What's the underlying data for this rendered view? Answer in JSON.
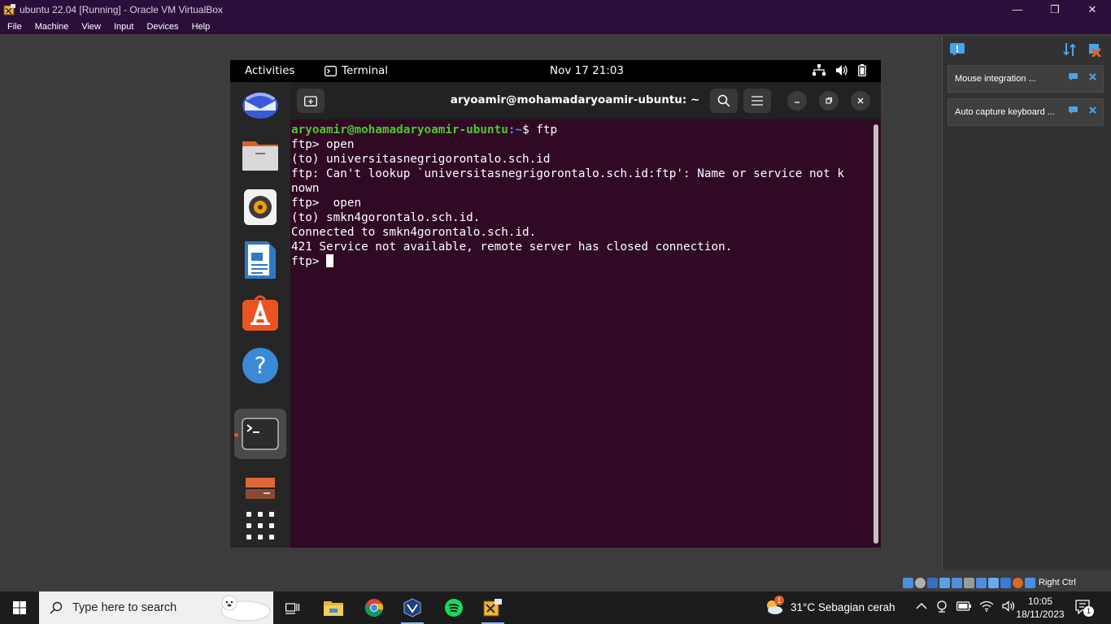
{
  "window": {
    "title": "ubuntu 22.04 [Running] - Oracle VM VirtualBox",
    "minimize": "—",
    "maximize": "❐",
    "close": "✕"
  },
  "menu": [
    "File",
    "Machine",
    "View",
    "Input",
    "Devices",
    "Help"
  ],
  "gnome": {
    "activities": "Activities",
    "app_name": "Terminal",
    "clock": "Nov 17  21:03"
  },
  "dock_icons": [
    "thunderbird-icon",
    "files-icon",
    "rhythmbox-icon",
    "writer-icon",
    "app-center-icon",
    "help-icon",
    "terminal-icon",
    "disk-icon",
    "show-apps-icon"
  ],
  "terminal": {
    "title": "aryoamir@mohamadaryoamir-ubuntu: ~",
    "prompt_user": "aryoamir@mohamadaryoamir-ubuntu",
    "prompt_path": ":~",
    "first_cmd": "$ ftp",
    "lines": [
      "ftp> open",
      "(to) universitasnegrigorontalo.sch.id",
      "ftp: Can't lookup `universitasnegrigorontalo.sch.id:ftp': Name or service not k",
      "nown",
      "ftp>  open",
      "(to) smkn4gorontalo.sch.id.",
      "Connected to smkn4gorontalo.sch.id.",
      "421 Service not available, remote server has closed connection."
    ],
    "last_prompt": "ftp> "
  },
  "notifications": [
    {
      "text": "Mouse integration ..."
    },
    {
      "text": "Auto capture keyboard ..."
    }
  ],
  "status": {
    "host_key": "Right Ctrl"
  },
  "taskbar": {
    "search_placeholder": "Type here to search",
    "weather": "31°C  Sebagian cerah",
    "weather_badge": "1",
    "time": "10:05",
    "date": "18/11/2023",
    "notification_count": "1"
  }
}
